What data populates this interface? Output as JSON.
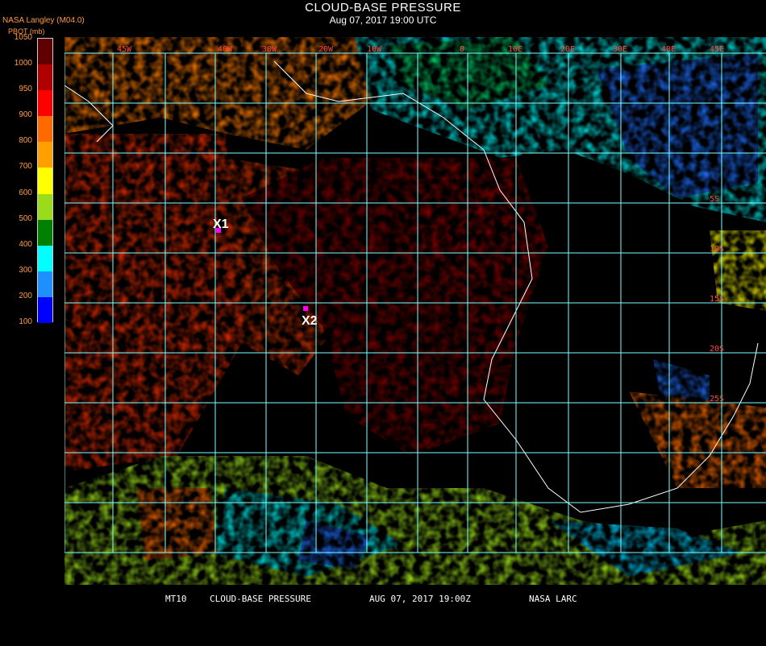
{
  "header": {
    "title": "CLOUD-BASE PRESSURE",
    "date": "Aug 07, 2017 19:00 UTC",
    "source": "NASA Langley (M04.0)",
    "units": "PBOT (mb)"
  },
  "legend": {
    "ticks": [
      "1050",
      "1000",
      "950",
      "900",
      "800",
      "700",
      "600",
      "500",
      "400",
      "300",
      "200",
      "100"
    ],
    "colors": [
      "#600000",
      "#b00000",
      "#ff0000",
      "#ff6a00",
      "#ffa000",
      "#ffff00",
      "#9adc1a",
      "#008000",
      "#00ffff",
      "#1e8fff",
      "#0000ff",
      "#9a40ff"
    ]
  },
  "markers": [
    {
      "id": "X1",
      "label": "X1",
      "color": "#ff00ff"
    },
    {
      "id": "X2",
      "label": "X2",
      "color": "#ff00ff"
    }
  ],
  "grid": {
    "color": "#7fffff",
    "lon_labels": [
      "45W",
      "40W",
      "30W",
      "20W",
      "10W",
      "0",
      "10E",
      "20E",
      "30E",
      "40E",
      "45E"
    ],
    "lat_labels": [
      "5S",
      "10S",
      "15S",
      "20S",
      "25S"
    ]
  },
  "footer": {
    "product": "MT10",
    "name": "CLOUD-BASE PRESSURE",
    "date": "AUG 07, 2017 19:00Z",
    "org": "NASA LARC"
  }
}
